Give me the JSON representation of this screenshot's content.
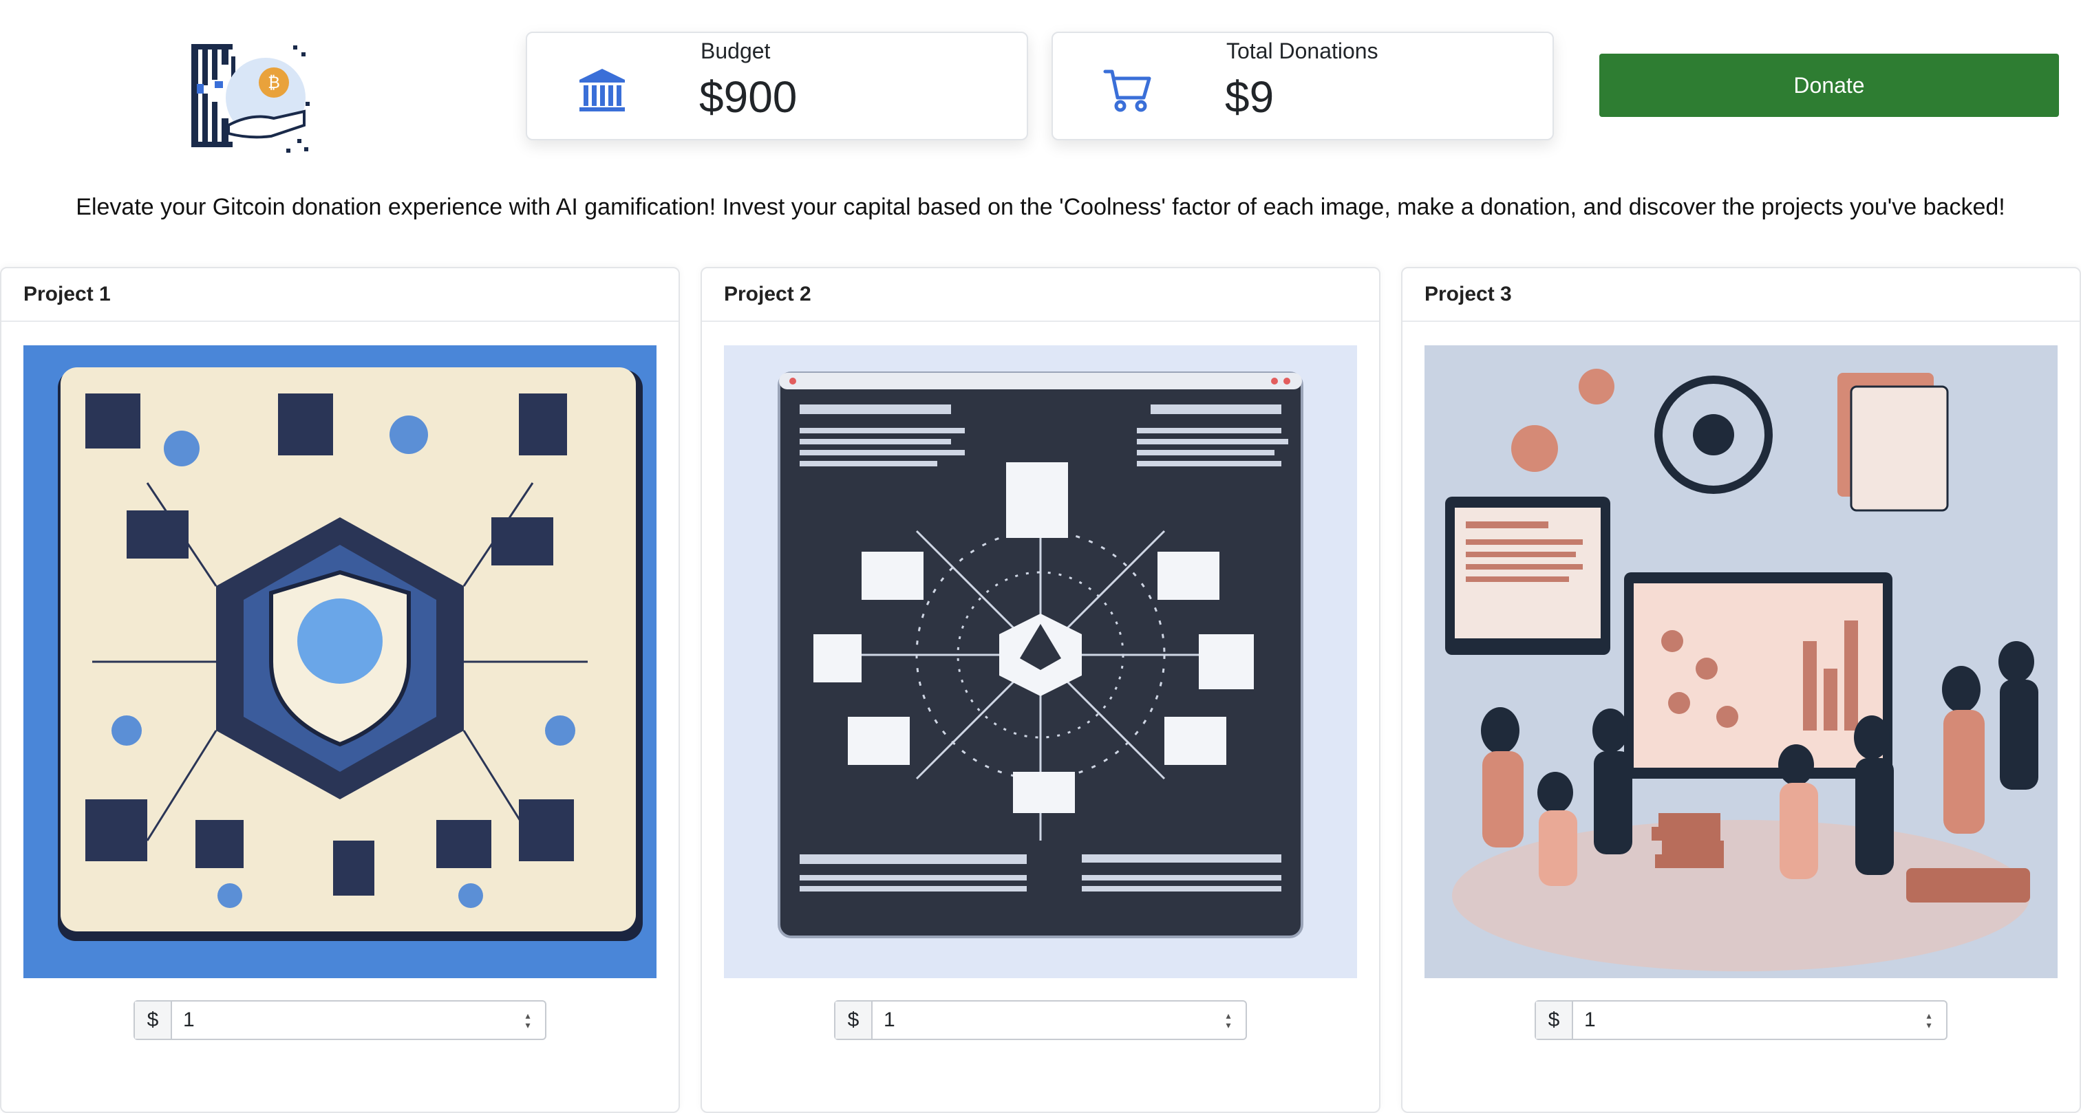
{
  "header": {
    "logo_icon": "hand-crypto-logo-icon",
    "budget": {
      "label": "Budget",
      "value": "$900",
      "icon": "bank-icon"
    },
    "donations": {
      "label": "Total Donations",
      "value": "$9",
      "icon": "cart-icon"
    },
    "donate_label": "Donate"
  },
  "tagline": "Elevate your Gitcoin donation experience with AI gamification! Invest your capital based on the 'Coolness' factor of each image, make a donation, and discover the projects you've backed!",
  "projects": [
    {
      "title": "Project 1",
      "currency": "$",
      "amount": "1"
    },
    {
      "title": "Project 2",
      "currency": "$",
      "amount": "1"
    },
    {
      "title": "Project 3",
      "currency": "$",
      "amount": "1"
    }
  ],
  "colors": {
    "accent": "#2e7d32",
    "icon_blue": "#3a6fd8"
  }
}
